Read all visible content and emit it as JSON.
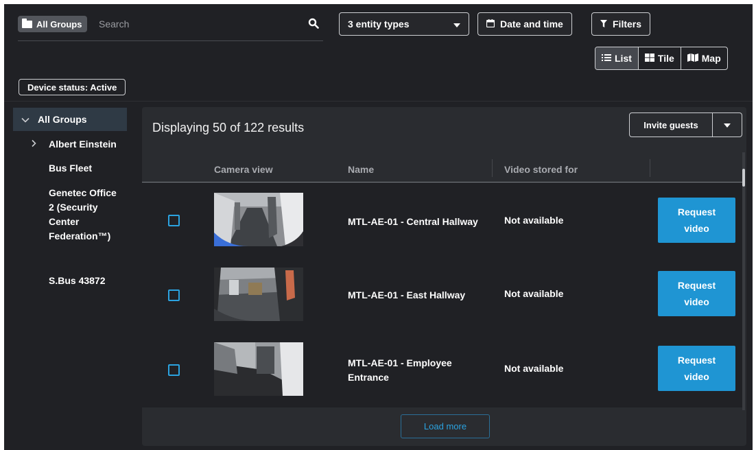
{
  "search": {
    "group_label": "All Groups",
    "placeholder": "Search"
  },
  "toolbar": {
    "entity_types": "3 entity types",
    "date_time": "Date and time",
    "filters": "Filters"
  },
  "views": [
    {
      "label": "List",
      "icon": "list-icon",
      "active": true
    },
    {
      "label": "Tile",
      "icon": "tile-icon",
      "active": false
    },
    {
      "label": "Map",
      "icon": "map-icon",
      "active": false
    }
  ],
  "status_chip": "Device status: Active",
  "sidebar": {
    "root": "All Groups",
    "items": [
      {
        "label": "Albert Einstein",
        "expandable": true
      },
      {
        "label": "Bus Fleet",
        "expandable": false
      },
      {
        "label": "Genetec Office 2 (Security Center Federation™)",
        "expandable": false
      },
      {
        "label": "S.Bus 43872",
        "expandable": false
      }
    ]
  },
  "results": {
    "summary": "Displaying 50 of 122 results",
    "invite_label": "Invite guests",
    "columns": [
      "Camera view",
      "Name",
      "Video stored for"
    ],
    "rows": [
      {
        "name": "MTL-AE-01 - Central Hallway",
        "stored": "Not available",
        "action": "Request video"
      },
      {
        "name": "MTL-AE-01 - East Hallway",
        "stored": "Not available",
        "action": "Request video"
      },
      {
        "name": "MTL-AE-01 - Employee Entrance",
        "stored": "Not available",
        "action": "Request video"
      }
    ],
    "load_more": "Load more"
  },
  "colors": {
    "background": "#202125",
    "panel": "#2a2c30",
    "accent": "#1f95d3",
    "selected_tree": "#2f3a45"
  }
}
